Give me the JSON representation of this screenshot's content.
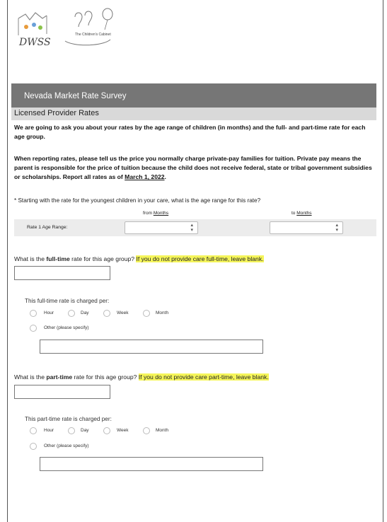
{
  "logos": {
    "dwss_text": "DWSS",
    "cabinet_text": "The Children's Cabinet"
  },
  "header": {
    "title": "Nevada Market Rate Survey"
  },
  "section": {
    "title": "Licensed Provider Rates"
  },
  "intro": {
    "paragraph1": "We are going to ask you about your rates by the age range of children (in months) and the full- and part-time rate for each age group.",
    "paragraph2_main": "When reporting rates, please tell us the price you normally charge private-pay families for tuition. Private pay means the parent is responsible for the price of tuition because the child does not receive federal, state or tribal government subsidies or scholarships. Report all rates as of ",
    "paragraph2_date": "March 1, 2022",
    "paragraph2_end": "."
  },
  "age_question": {
    "text": "* Starting with the rate for the youngest children in your care, what is the age range for this rate?",
    "from_prefix": "from ",
    "from_unit": "Months",
    "to_prefix": "to ",
    "to_unit": "Months",
    "row_label": "Rate 1 Age Range:"
  },
  "full_time": {
    "question_prefix": "What is the ",
    "question_bold": "full-time",
    "question_suffix": " rate for this age group? ",
    "hint": "If you do not provide care full-time, leave blank.",
    "charged_per": "This full-time rate is charged per:",
    "options": [
      "Hour",
      "Day",
      "Week",
      "Month"
    ],
    "other": "Other (please specify)"
  },
  "part_time": {
    "question_prefix": "What is the ",
    "question_bold": "part-time",
    "question_suffix": " rate for this age group? ",
    "hint": "If you do not provide care part-time, leave blank.",
    "charged_per": "This part-time rate is charged per:",
    "options": [
      "Hour",
      "Day",
      "Week",
      "Month"
    ],
    "other": "Other (please specify)"
  },
  "colors": {
    "header_bg": "#767676",
    "section_bg": "#d9d9d9",
    "hint_bg": "#f5f55a",
    "row_bg": "#ececec"
  },
  "icons": {
    "dwss_logo": "dwss-logo-icon",
    "cabinet_logo": "childrens-cabinet-logo-icon",
    "select_arrows": "updown-arrows-icon"
  }
}
